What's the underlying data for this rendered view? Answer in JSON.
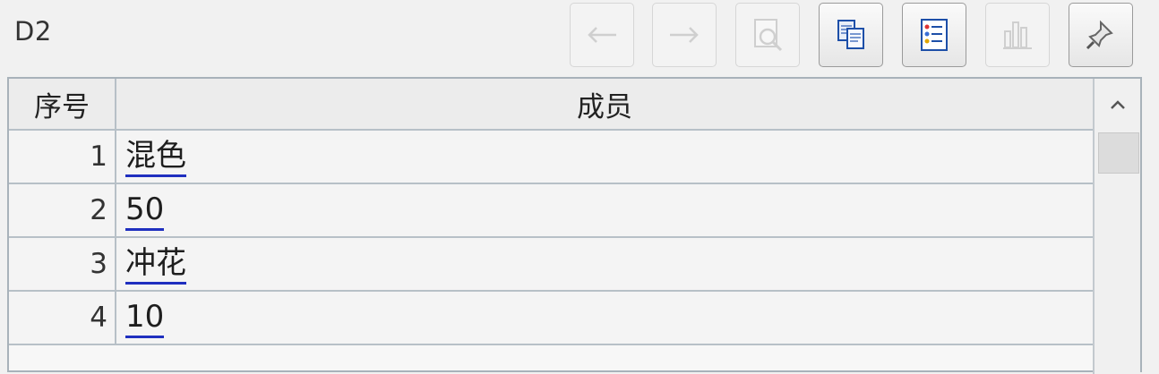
{
  "cell_name": "D2",
  "toolbar": {
    "buttons": [
      {
        "name": "back",
        "icon": "arrow-left-icon",
        "enabled": false
      },
      {
        "name": "forward",
        "icon": "arrow-right-icon",
        "enabled": false
      },
      {
        "name": "preview",
        "icon": "magnifier-document-icon",
        "enabled": false
      },
      {
        "name": "copy",
        "icon": "copy-icon",
        "enabled": true
      },
      {
        "name": "list",
        "icon": "list-icon",
        "enabled": true
      },
      {
        "name": "chart",
        "icon": "bar-chart-icon",
        "enabled": false
      },
      {
        "name": "pin",
        "icon": "pin-icon",
        "enabled": true
      }
    ]
  },
  "table": {
    "headers": {
      "index": "序号",
      "member": "成员"
    },
    "rows": [
      {
        "index": "1",
        "member": "混色"
      },
      {
        "index": "2",
        "member": "50"
      },
      {
        "index": "3",
        "member": "冲花"
      },
      {
        "index": "4",
        "member": "10"
      }
    ]
  },
  "colors": {
    "link_underline": "#1f2fbf",
    "grid_line": "#b7c0c7"
  }
}
